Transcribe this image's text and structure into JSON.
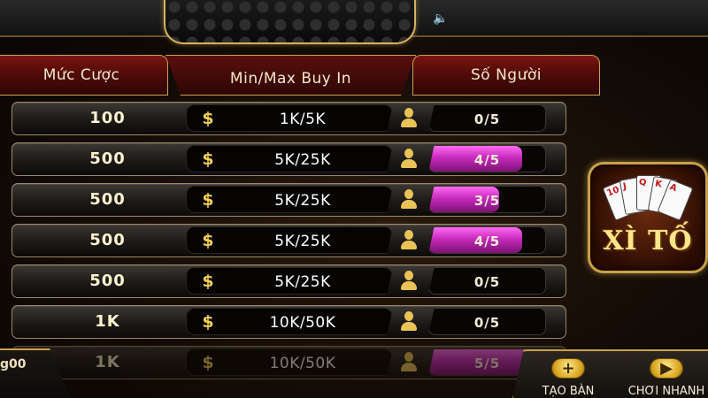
{
  "header": {
    "col_bet": "Mức Cược",
    "col_buyin": "Min/Max Buy In",
    "col_players": "Số Người"
  },
  "rows": [
    {
      "bet": "100",
      "buyin": "1K/5K",
      "players": "0/5",
      "fill": 0
    },
    {
      "bet": "500",
      "buyin": "5K/25K",
      "players": "4/5",
      "fill": 0.8
    },
    {
      "bet": "500",
      "buyin": "5K/25K",
      "players": "3/5",
      "fill": 0.6
    },
    {
      "bet": "500",
      "buyin": "5K/25K",
      "players": "4/5",
      "fill": 0.8
    },
    {
      "bet": "500",
      "buyin": "5K/25K",
      "players": "0/5",
      "fill": 0
    },
    {
      "bet": "1K",
      "buyin": "10K/50K",
      "players": "0/5",
      "fill": 0
    },
    {
      "bet": "1K",
      "buyin": "10K/50K",
      "players": "5/5",
      "fill": 1.0
    }
  ],
  "game": {
    "title": "XÌ TỐ"
  },
  "balance": {
    "text": "g00"
  },
  "actions": {
    "create_table": "TẠO BÀN",
    "play_now": "CHƠI NHANH"
  },
  "icons": {
    "sound": "speaker-icon",
    "currency": "dollar-icon",
    "player": "user-icon",
    "create": "plus-icon",
    "play": "play-icon"
  },
  "colors": {
    "accent_gold": "#c9a14a",
    "header_red": "#7a1410",
    "player_fill": "#c72bbd"
  }
}
